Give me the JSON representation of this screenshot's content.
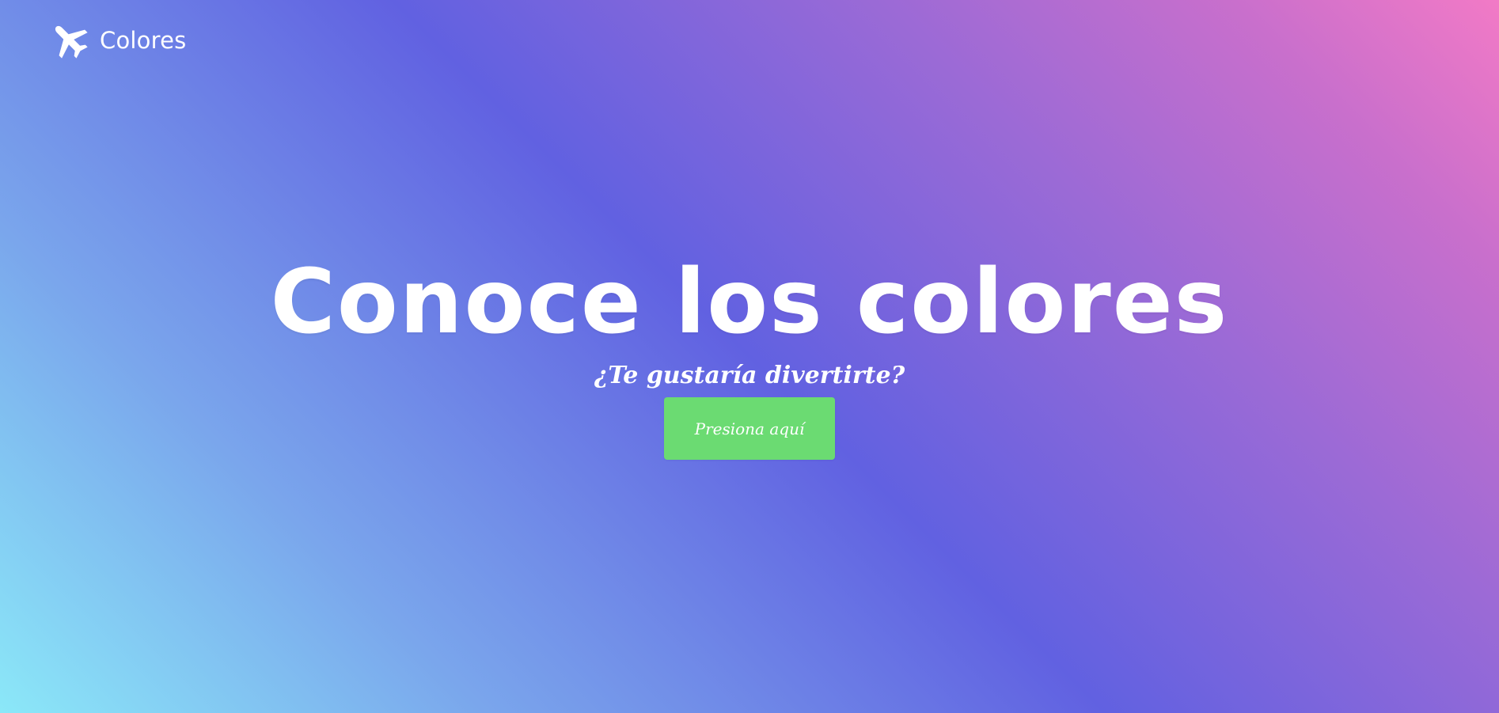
{
  "header": {
    "brand_icon": "airplane-icon",
    "brand_name": "Colores"
  },
  "hero": {
    "title": "Conoce los colores",
    "subtitle": "¿Te gustaría divertirte?",
    "button_label": "Presiona aquí"
  },
  "colors": {
    "gradient": [
      "#8be8f8",
      "#7aa6ec",
      "#6161e1",
      "#9b6ad6",
      "#c96fcc",
      "#f27ac6"
    ],
    "button_background": "#6bdb72",
    "text": "#ffffff"
  }
}
